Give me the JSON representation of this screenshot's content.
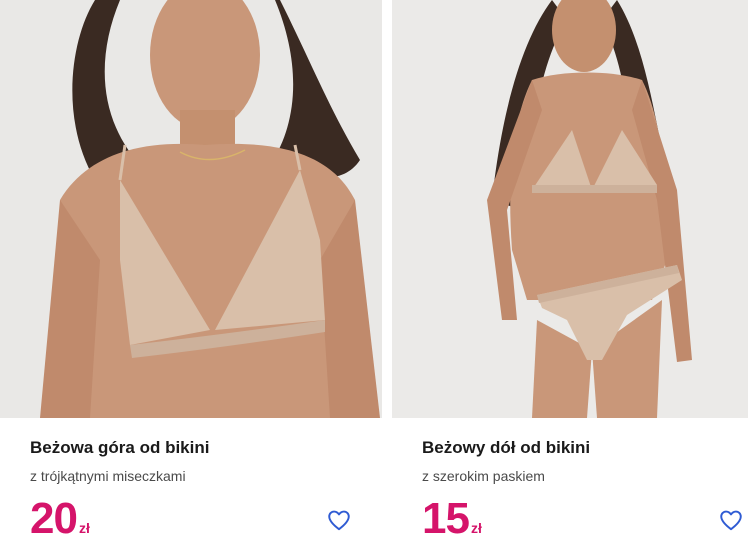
{
  "products": [
    {
      "title": "Beżowa góra od bikini",
      "subtitle": "z trójkątnymi miseczkami",
      "price": "20",
      "currency": "zł",
      "favorite_icon": "heart-outline-icon"
    },
    {
      "title": "Beżowy dół od bikini",
      "subtitle": "z szerokim paskiem",
      "price": "15",
      "currency": "zł",
      "favorite_icon": "heart-outline-icon"
    }
  ],
  "colors": {
    "price": "#d5146a",
    "favorite_icon": "#2f5bd3",
    "title": "#1a1a1a",
    "photo_background": "#e9e8e6",
    "swimwear": "#d9bfa9"
  }
}
